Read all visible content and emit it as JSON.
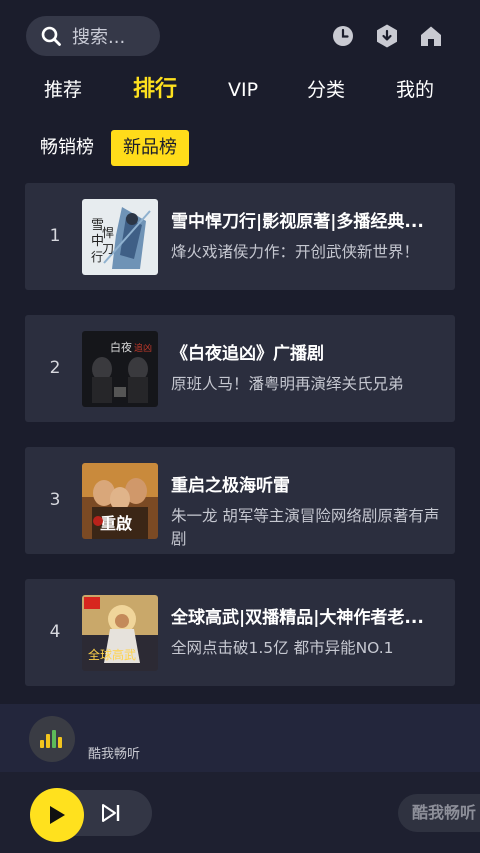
{
  "search": {
    "placeholder": "搜索..."
  },
  "header_icons": [
    "clock-icon",
    "download-icon",
    "home-icon"
  ],
  "tabs": [
    {
      "label": "推荐"
    },
    {
      "label": "排行"
    },
    {
      "label": "VIP"
    },
    {
      "label": "分类"
    },
    {
      "label": "我的"
    }
  ],
  "active_tab": "排行",
  "subtabs": [
    {
      "label": "畅销榜"
    },
    {
      "label": "新品榜"
    }
  ],
  "active_subtab": "新品榜",
  "items": [
    {
      "rank": "1",
      "title": "雪中悍刀行|影视原著|多播经典...",
      "desc": "烽火戏诸侯力作：开创武侠新世界！"
    },
    {
      "rank": "2",
      "title": "《白夜追凶》广播剧",
      "desc": "原班人马！潘粤明再演绎关氏兄弟"
    },
    {
      "rank": "3",
      "title": "重启之极海听雷",
      "desc": "朱一龙 胡军等主演冒险网络剧原著有声剧"
    },
    {
      "rank": "4",
      "title": "全球高武|双播精品|大神作者老...",
      "desc": "全网点击破1.5亿 都市异能NO.1"
    }
  ],
  "player": {
    "brand_small": "酷我畅听",
    "brand_button": "酷我畅听"
  },
  "colors": {
    "accent": "#ffe11e",
    "background": "#1b1d2c",
    "card": "#2b2e3e"
  }
}
